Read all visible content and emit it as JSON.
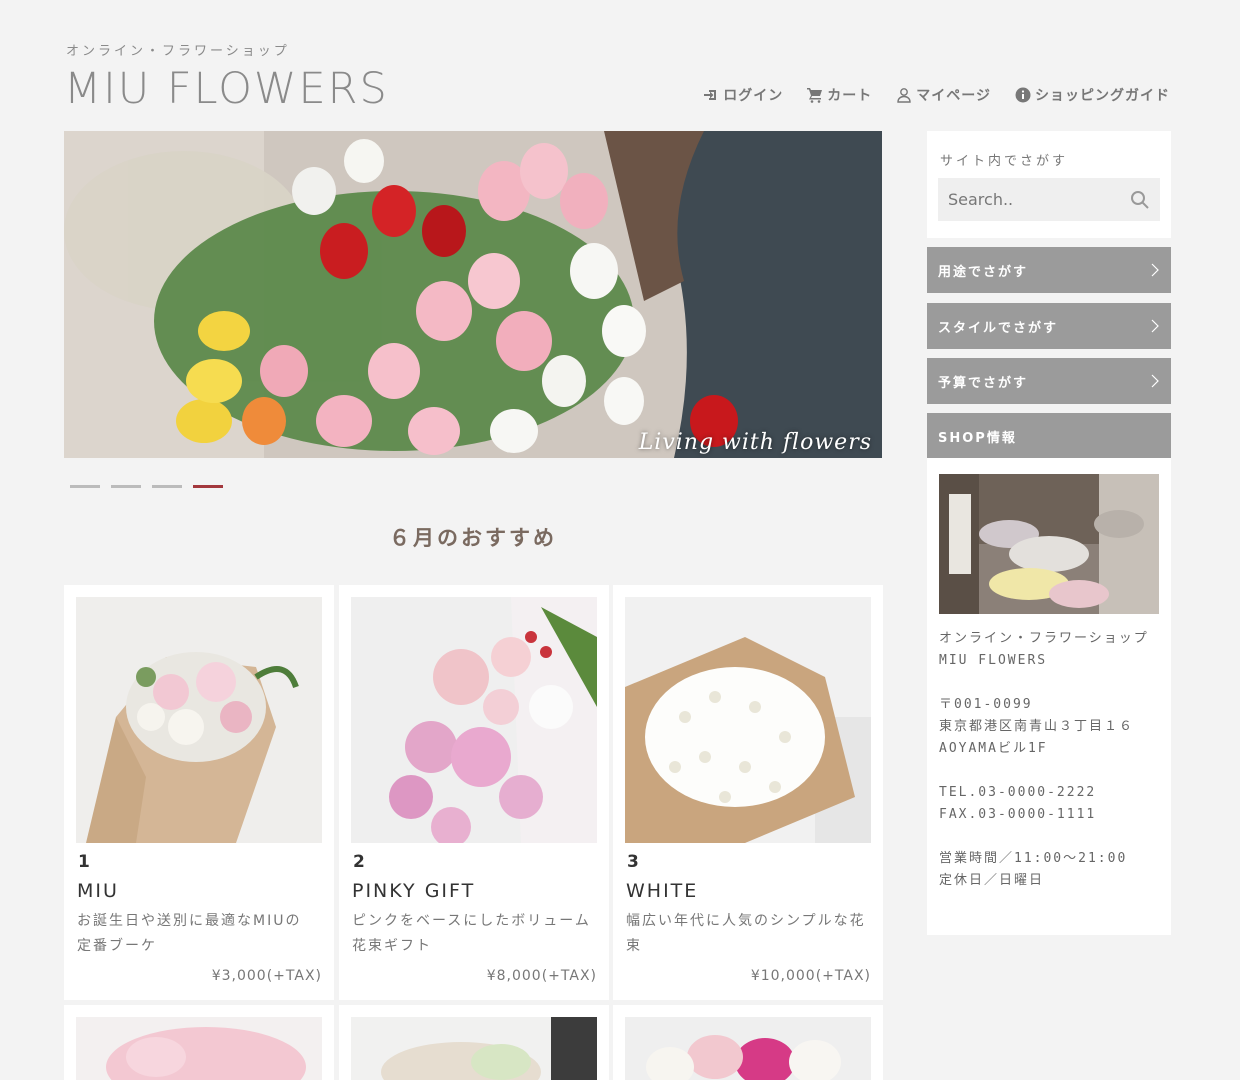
{
  "brand": {
    "subtitle": "オンライン・フラワーショップ",
    "title": "MIU FLOWERS"
  },
  "nav": [
    {
      "label": "ログイン",
      "icon": "sign-in-icon"
    },
    {
      "label": "カート",
      "icon": "cart-icon"
    },
    {
      "label": "マイページ",
      "icon": "user-icon"
    },
    {
      "label": "ショッピングガイド",
      "icon": "info-icon"
    }
  ],
  "hero": {
    "caption": "Living with flowers",
    "slides": 4,
    "active_slide": 4
  },
  "section": {
    "title": "６月のおすすめ"
  },
  "products": [
    {
      "num": "1",
      "name": "MIU",
      "desc": "お誕生日や送別に最適なMIUの定番ブーケ",
      "price": "¥3,000(+TAX)"
    },
    {
      "num": "2",
      "name": "PINKY GIFT",
      "desc": "ピンクをベースにしたボリューム花束ギフト",
      "price": "¥8,000(+TAX)"
    },
    {
      "num": "3",
      "name": "WHITE",
      "desc": "幅広い年代に人気のシンプルな花束",
      "price": "¥10,000(+TAX)"
    }
  ],
  "sidebar": {
    "search_label": "サイト内でさがす",
    "search_placeholder": "Search..",
    "menu": [
      "用途でさがす",
      "スタイルでさがす",
      "予算でさがす"
    ],
    "shop_heading": "SHOP情報",
    "shop": {
      "line1": "オンライン・フラワーショップ",
      "line2": "MIU FLOWERS",
      "postal": "〒001-0099",
      "address1": "東京都港区南青山３丁目１６",
      "address2": "AOYAMAビル1F",
      "tel": "TEL.03-0000-2222",
      "fax": "FAX.03-0000-1111",
      "hours": "営業時間／11:00〜21:00",
      "closed": "定休日／日曜日"
    }
  },
  "colors": {
    "background": "#f3f3f3",
    "sidebar_button": "#9b9b9b",
    "slider_active": "#a3383d",
    "section_title": "#7a6a60"
  }
}
